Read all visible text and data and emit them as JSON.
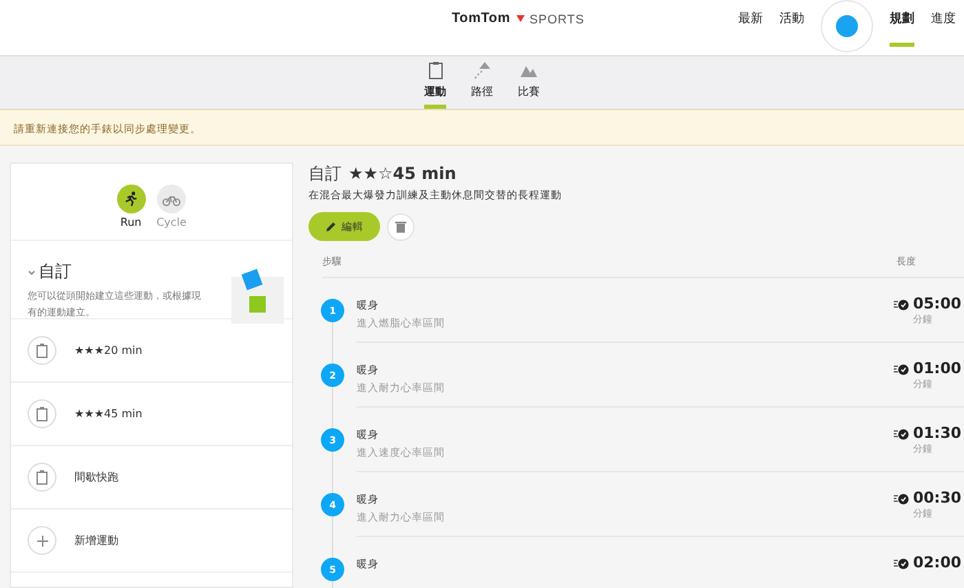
{
  "header": {
    "logo": {
      "brand": "TomTom",
      "product": "SPORTS"
    },
    "nav": [
      {
        "label": "最新",
        "selected": false,
        "kind": "link"
      },
      {
        "label": "活動",
        "selected": false,
        "kind": "link"
      },
      {
        "kind": "avatar"
      },
      {
        "label": "規劃",
        "selected": true,
        "kind": "link"
      },
      {
        "label": "進度",
        "selected": false,
        "kind": "link"
      }
    ]
  },
  "subnav": [
    {
      "label": "運動",
      "selected": true,
      "kind": "clipboard"
    },
    {
      "label": "路徑",
      "selected": false,
      "kind": "route"
    },
    {
      "label": "比賽",
      "selected": false,
      "kind": "race"
    }
  ],
  "banner": "請重新連接您的手錶以同步處理變更。",
  "sidebar": {
    "sports": [
      {
        "label": "Run",
        "selected": true,
        "kind": "run"
      },
      {
        "label": "Cycle",
        "selected": false,
        "kind": "cycle"
      }
    ],
    "section": {
      "title": "自訂",
      "expanded": true,
      "description": "您可以從頭開始建立這些運動，或根據現有的運動建立。"
    },
    "items": [
      {
        "label": "★★★20 min",
        "kind": "workout"
      },
      {
        "label": "★★★45 min",
        "kind": "workout"
      },
      {
        "label": "間歇快跑",
        "kind": "workout"
      },
      {
        "label": "新增運動",
        "kind": "add"
      }
    ]
  },
  "workout": {
    "category": "自訂",
    "title": "★★☆45 min",
    "description": "在混合最大爆發力訓練及主動休息間交替的長程運動",
    "edit_button": "編輯",
    "columns": [
      "步驟",
      "長度"
    ],
    "steps": [
      {
        "number": "1",
        "title": "暖身",
        "subtitle": "進入燃脂心率區間",
        "duration": "05:00",
        "unit": "分鐘"
      },
      {
        "number": "2",
        "title": "暖身",
        "subtitle": "進入耐力心率區間",
        "duration": "01:00",
        "unit": "分鐘"
      },
      {
        "number": "3",
        "title": "暖身",
        "subtitle": "進入速度心率區間",
        "duration": "01:30",
        "unit": "分鐘"
      },
      {
        "number": "4",
        "title": "暖身",
        "subtitle": "進入耐力心率區間",
        "duration": "00:30",
        "unit": "分鐘"
      },
      {
        "number": "5",
        "title": "暖身",
        "duration": "02:00"
      }
    ]
  }
}
